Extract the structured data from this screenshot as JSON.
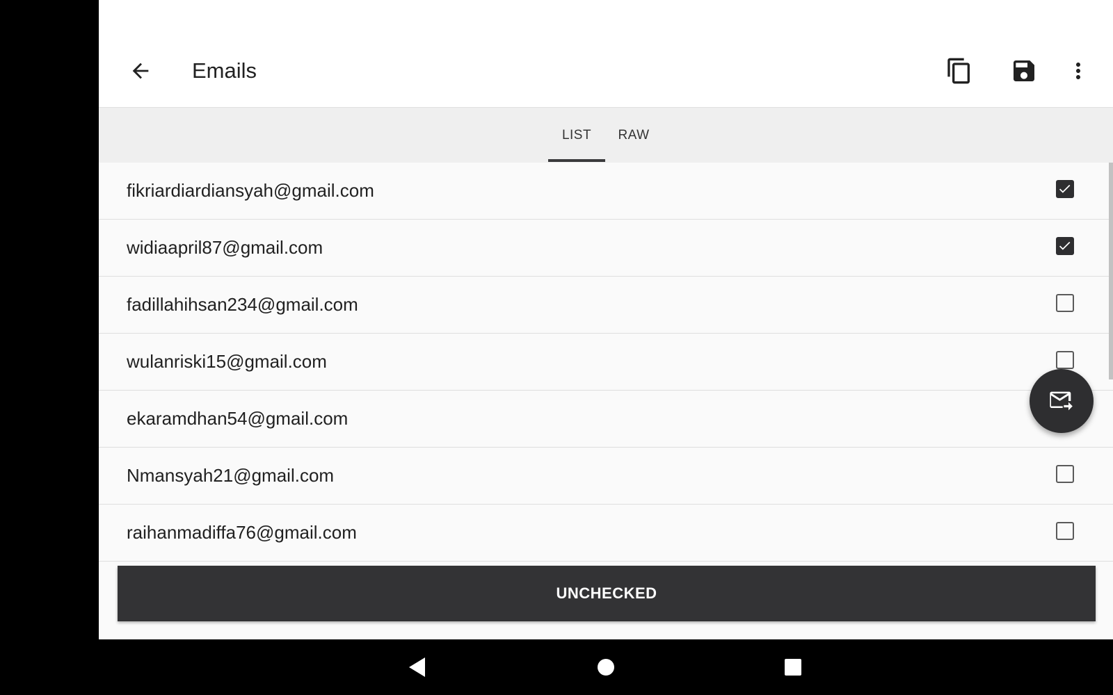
{
  "app": {
    "title": "Emails"
  },
  "toolbar": {
    "back_icon": "arrow-left-icon",
    "actions": [
      "copy-icon",
      "save-icon",
      "more-vert-icon"
    ]
  },
  "tabs": [
    {
      "label": "LIST",
      "selected": true
    },
    {
      "label": "RAW",
      "selected": false
    }
  ],
  "emails": [
    {
      "address": "fikriardiardiansyah@gmail.com",
      "checked": true
    },
    {
      "address": "widiaapril87@gmail.com",
      "checked": true
    },
    {
      "address": "fadillahihsan234@gmail.com",
      "checked": false
    },
    {
      "address": "wulanriski15@gmail.com",
      "checked": false
    },
    {
      "address": "ekaramdhan54@gmail.com",
      "checked": false
    },
    {
      "address": "Nmansyah21@gmail.com",
      "checked": false
    },
    {
      "address": "raihanmadiffa76@gmail.com",
      "checked": false
    }
  ],
  "fab": {
    "icon": "forward-email-icon"
  },
  "footer_button": {
    "label": "UNCHECKED"
  },
  "colors": {
    "accent": "#2e2e30",
    "background": "#fafafa",
    "tab_bar": "#efefef"
  },
  "navbar": {
    "icons": [
      "nav-back-icon",
      "nav-home-icon",
      "nav-recents-icon"
    ]
  }
}
